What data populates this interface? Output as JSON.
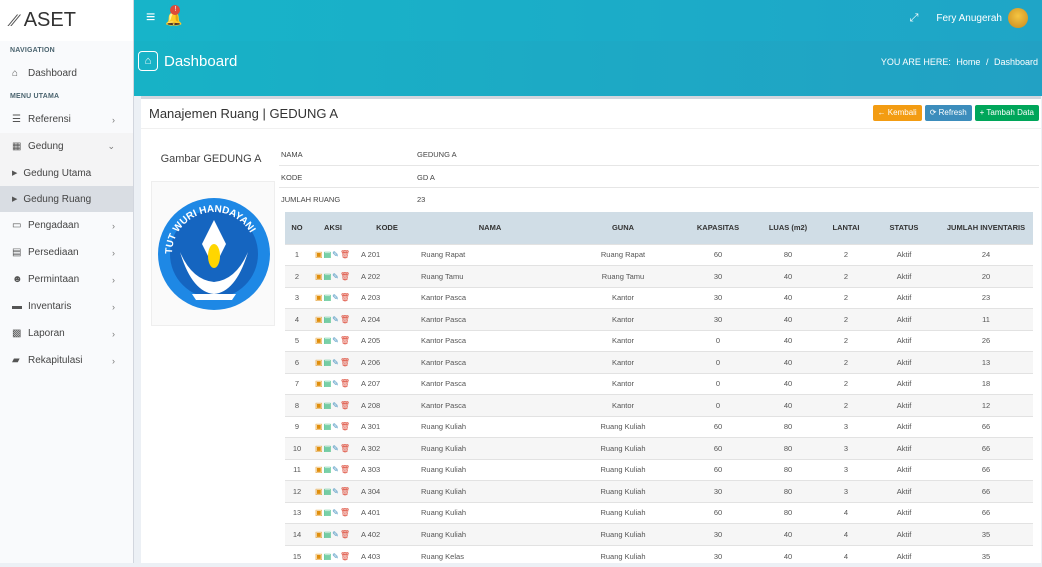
{
  "app": {
    "brand": "ASET"
  },
  "sidebar": {
    "nav_header": "NAVIGATION",
    "menu_header": "MENU UTAMA",
    "items": [
      {
        "label": "Dashboard",
        "icon": "home-icon"
      },
      {
        "label": "Referensi",
        "icon": "list-icon"
      },
      {
        "label": "Gedung",
        "icon": "building-icon"
      },
      {
        "label": "Pengadaan",
        "icon": "laptop-icon"
      },
      {
        "label": "Persediaan",
        "icon": "table-icon"
      },
      {
        "label": "Permintaan",
        "icon": "users-icon"
      },
      {
        "label": "Inventaris",
        "icon": "car-icon"
      },
      {
        "label": "Laporan",
        "icon": "grid-icon"
      },
      {
        "label": "Rekapitulasi",
        "icon": "book-icon"
      }
    ],
    "subitems": [
      {
        "label": "Gedung Utama"
      },
      {
        "label": "Gedung Ruang"
      }
    ]
  },
  "topbar": {
    "notif_count": "!",
    "user_name": "Fery Anugerah"
  },
  "page": {
    "title": "Dashboard",
    "breadcrumb_label": "YOU ARE HERE:",
    "breadcrumb_home": "Home",
    "breadcrumb_sep": "/",
    "breadcrumb_current": "Dashboard"
  },
  "box": {
    "title": "Manajemen Ruang | GEDUNG A",
    "btn_back": "Kembali",
    "btn_refresh": "Refresh",
    "btn_add": "Tambah Data",
    "image_title": "Gambar GEDUNG A",
    "logo_text": "TUT WURI HANDAYANI",
    "logo_caption": "Tut Wuri Handayani"
  },
  "info": {
    "nama_label": "NAMA",
    "nama_value": "GEDUNG A",
    "kode_label": "KODE",
    "kode_value": "GD A",
    "jumlah_label": "JUMLAH RUANG",
    "jumlah_value": "23"
  },
  "table": {
    "headers": [
      "NO",
      "AKSI",
      "KODE",
      "NAMA",
      "GUNA",
      "KAPASITAS",
      "LUAS (m2)",
      "LANTAI",
      "STATUS",
      "JUMLAH INVENTARIS"
    ],
    "rows": [
      [
        "1",
        "A 201",
        "Ruang Rapat",
        "Ruang Rapat",
        "60",
        "80",
        "2",
        "Aktif",
        "24"
      ],
      [
        "2",
        "A 202",
        "Ruang Tamu",
        "Ruang Tamu",
        "30",
        "40",
        "2",
        "Aktif",
        "20"
      ],
      [
        "3",
        "A 203",
        "Kantor Pasca",
        "Kantor",
        "30",
        "40",
        "2",
        "Aktif",
        "23"
      ],
      [
        "4",
        "A 204",
        "Kantor Pasca",
        "Kantor",
        "30",
        "40",
        "2",
        "Aktif",
        "11"
      ],
      [
        "5",
        "A 205",
        "Kantor Pasca",
        "Kantor",
        "0",
        "40",
        "2",
        "Aktif",
        "26"
      ],
      [
        "6",
        "A 206",
        "Kantor Pasca",
        "Kantor",
        "0",
        "40",
        "2",
        "Aktif",
        "13"
      ],
      [
        "7",
        "A 207",
        "Kantor Pasca",
        "Kantor",
        "0",
        "40",
        "2",
        "Aktif",
        "18"
      ],
      [
        "8",
        "A 208",
        "Kantor Pasca",
        "Kantor",
        "0",
        "40",
        "2",
        "Aktif",
        "12"
      ],
      [
        "9",
        "A 301",
        "Ruang Kuliah",
        "Ruang Kuliah",
        "60",
        "80",
        "3",
        "Aktif",
        "66"
      ],
      [
        "10",
        "A 302",
        "Ruang Kuliah",
        "Ruang Kuliah",
        "60",
        "80",
        "3",
        "Aktif",
        "66"
      ],
      [
        "11",
        "A 303",
        "Ruang Kuliah",
        "Ruang Kuliah",
        "60",
        "80",
        "3",
        "Aktif",
        "66"
      ],
      [
        "12",
        "A 304",
        "Ruang Kuliah",
        "Ruang Kuliah",
        "30",
        "80",
        "3",
        "Aktif",
        "66"
      ],
      [
        "13",
        "A 401",
        "Ruang Kuliah",
        "Ruang Kuliah",
        "60",
        "80",
        "4",
        "Aktif",
        "66"
      ],
      [
        "14",
        "A 402",
        "Ruang Kuliah",
        "Ruang Kuliah",
        "30",
        "40",
        "4",
        "Aktif",
        "35"
      ],
      [
        "15",
        "A 403",
        "Ruang Kelas",
        "Ruang Kuliah",
        "30",
        "40",
        "4",
        "Aktif",
        "35"
      ]
    ]
  }
}
